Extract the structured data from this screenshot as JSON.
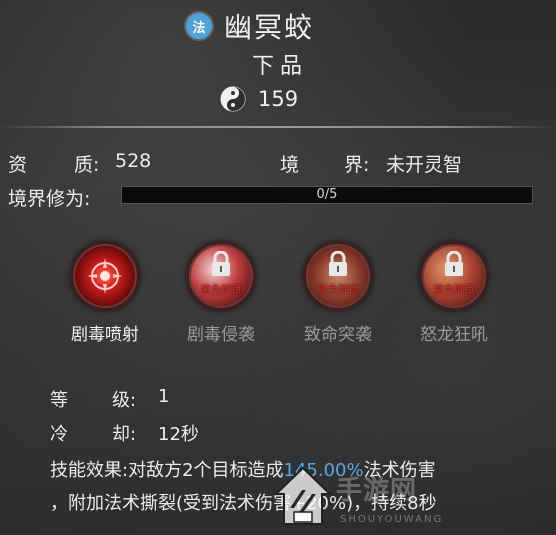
{
  "header": {
    "badge": "法",
    "name": "幽冥蛟",
    "grade": "下品",
    "power_icon": "yinyang-icon",
    "power": "159"
  },
  "stats": {
    "aptitude_label_1": "资",
    "aptitude_label_2": "质:",
    "aptitude_value": "528",
    "realm_label_1": "境",
    "realm_label_2": "界:",
    "realm_value": "未开灵智",
    "cultivation_label": "境界修为:",
    "cultivation_text": "0/5",
    "cultivation_progress": 0
  },
  "skills": [
    {
      "name": "剧毒喷射",
      "lock_text": "",
      "locked": false
    },
    {
      "name": "剧毒侵袭",
      "lock_text": "紫色解锁",
      "locked": true
    },
    {
      "name": "致命突袭",
      "lock_text": "蓝色解锁",
      "locked": true
    },
    {
      "name": "怒龙狂吼",
      "lock_text": "紫色解锁",
      "locked": true
    }
  ],
  "detail": {
    "level_label_1": "等",
    "level_label_2": "级:",
    "level_value": "1",
    "cooldown_label_1": "冷",
    "cooldown_label_2": "却:",
    "cooldown_value": "12秒",
    "effect_label": "技能效果:",
    "effect_part1": "对敌方2个目标造成",
    "effect_highlight": "145.00%",
    "effect_part2": "法术伤害",
    "effect_line2": "，附加法术撕裂(受到法术伤害+20%)，持续8秒"
  },
  "colors": {
    "highlight": "#5aa6e0",
    "badge": "#4fa3d9",
    "lock_text": "#e03030"
  },
  "watermark": {
    "text": "手游网",
    "sub": "SHOUYOUWANG"
  }
}
